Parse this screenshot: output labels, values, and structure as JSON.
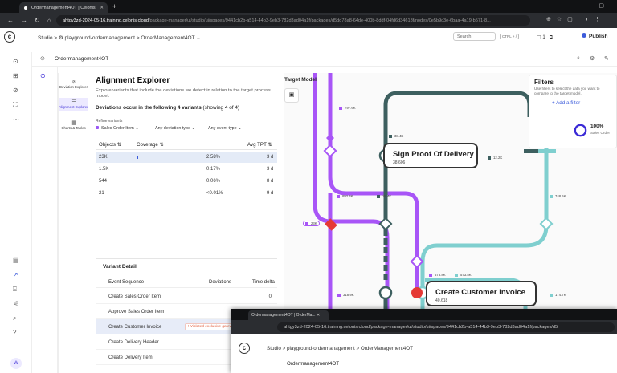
{
  "browser": {
    "tab_title": "Ordermanagement4OT | Celonis",
    "url_host": "ahtgy3zd-2024-05-16.training.celonis.cloud",
    "url_path": "/package-manager/ui/studio/ui/spaces/9441cb2b-a514-44b3-9eb3-782d3ad04a1f/packages/d5dd78a8-64de-400b-8ddf-04fd6d34618f/nodes/0e5b9c3e-6baa-4a19-b571-8..."
  },
  "app": {
    "logo": "c",
    "breadcrumb": [
      "Studio",
      "playground-ordermanagement",
      "OrderManagement4OT"
    ],
    "search_placeholder": "Search",
    "shortcut": "CTRL + /",
    "counter": "1",
    "publish": "Publish",
    "subheader": "Ordermanagement4OT",
    "avatar": "W"
  },
  "menu": [
    {
      "label": "Deviation Explorer",
      "icon": "⌀"
    },
    {
      "label": "Alignment Explorer",
      "icon": "☰"
    },
    {
      "label": "Charts & Tables",
      "icon": "▦"
    }
  ],
  "ae": {
    "title": "Alignment Explorer",
    "description": "Explore variants that include the deviations we detect in relation to the target process model.",
    "deviations": "Deviations occur in the following 4 variants",
    "showing": "(showing 4 of 4)",
    "refine": "Refine variants",
    "filters": [
      "Sales Order Item",
      "Any deviation type",
      "Any event type"
    ],
    "cols": [
      "Objects",
      "Coverage",
      "Avg TPT"
    ],
    "rows": [
      {
        "objects": "23K",
        "coverage": "2.58%",
        "tpt": "3 d"
      },
      {
        "objects": "1.5K",
        "coverage": "0.17%",
        "tpt": "3 d"
      },
      {
        "objects": "544",
        "coverage": "0.06%",
        "tpt": "8 d"
      },
      {
        "objects": "21",
        "coverage": "<0.01%",
        "tpt": "9 d"
      }
    ],
    "variant_detail": "Variant Detail",
    "es_cols": [
      "Event Sequence",
      "Deviations",
      "Time delta"
    ],
    "events": [
      {
        "name": "Create Sales Order Item",
        "delta": "0"
      },
      {
        "name": "Approve Sales Order Item",
        "delta": "1 d"
      },
      {
        "name": "Create Customer Invoice",
        "delta": "2 d",
        "badge": "Violated exclusive gateway"
      },
      {
        "name": "Create Delivery Header",
        "delta": ""
      },
      {
        "name": "Create Delivery Item",
        "delta": ""
      }
    ]
  },
  "model": {
    "title": "Target Model",
    "labels": [
      "797.6K",
      "38.4K",
      "892.4K",
      "38.4K",
      "23K",
      "12.2K",
      "748.5K",
      "573.8K",
      "573.8K",
      "318.9K",
      "174.7K",
      "573.8K",
      "573.8K"
    ],
    "activities": [
      {
        "name": "Sign Proof Of Delivery",
        "count": "38,606"
      },
      {
        "name": "Create Customer Invoice",
        "count": "40,618"
      }
    ]
  },
  "filters": {
    "title": "Filters",
    "desc": "Use filters to select the data you want to compare to the target model.",
    "add": "Add a filter",
    "pct": "100%",
    "obj": "Sales Order"
  },
  "overlay": {
    "tab": "Ordermanagement4OT | OrderMa...",
    "url": "ahtgy3zd-2024-05-16.training.celonis.cloud/package-manager/ui/studio/ui/spaces/9441cb2b-a514-44b3-9eb3-782d3ad04a1f/packages/d5",
    "bc": "Studio  >  playground-ordermanagement  >  OrderManagement4OT",
    "sub": "Ordermanagement4OT"
  },
  "colors": {
    "purple": "#a855f7",
    "teal": "#3d5f5f",
    "cyan": "#7fcfcf",
    "accent": "#3b5bdb"
  }
}
